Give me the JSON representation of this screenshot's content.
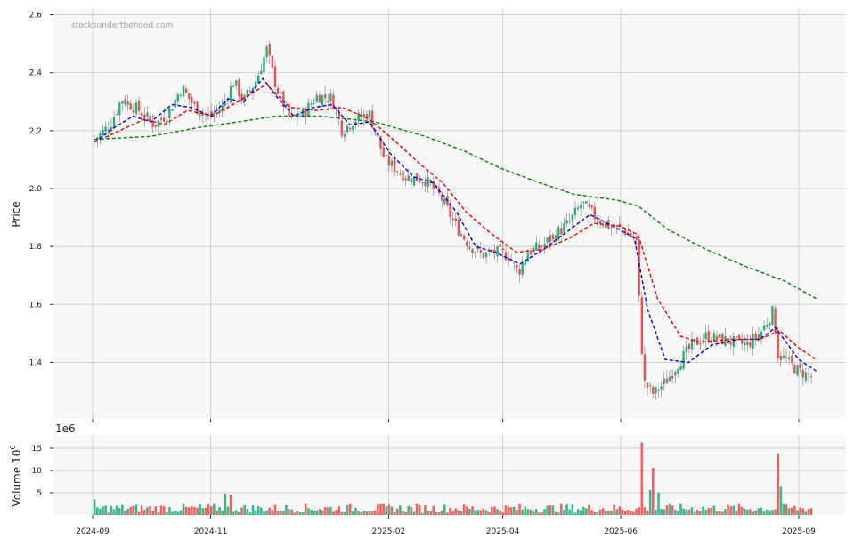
{
  "watermark": "stocksunderthehood.com",
  "colors": {
    "up": "#26b07a",
    "down": "#f05050",
    "ma_short": "#0000dd",
    "ma_mid": "#ee0000",
    "ma_long": "#008000",
    "panel_bg": "#f8f8f8",
    "grid": "#d0d0d0"
  },
  "chart_data": [
    {
      "type": "candlestick",
      "ylabel": "Price",
      "ylim": [
        1.205,
        2.62
      ],
      "yticks": [
        1.4,
        1.6,
        1.8,
        2.0,
        2.2,
        2.4,
        2.6
      ],
      "ytick_labels": [
        "1.4",
        "1.6",
        "1.8",
        "2.0",
        "2.2",
        "2.4",
        "2.6"
      ],
      "xticks": [
        "2024-09",
        "2024-11",
        "2025-02",
        "2025-04",
        "2025-06",
        "2025-09"
      ],
      "grid": true,
      "price_path": [
        [
          "2024-09-02",
          2.17
        ],
        [
          "2024-09-10",
          2.22
        ],
        [
          "2024-09-16",
          2.31
        ],
        [
          "2024-09-25",
          2.27
        ],
        [
          "2024-10-03",
          2.22
        ],
        [
          "2024-10-10",
          2.26
        ],
        [
          "2024-10-17",
          2.35
        ],
        [
          "2024-10-24",
          2.28
        ],
        [
          "2024-10-31",
          2.25
        ],
        [
          "2024-11-07",
          2.28
        ],
        [
          "2024-11-13",
          2.37
        ],
        [
          "2024-11-18",
          2.3
        ],
        [
          "2024-11-25",
          2.38
        ],
        [
          "2024-11-30",
          2.48
        ],
        [
          "2024-12-05",
          2.35
        ],
        [
          "2024-12-12",
          2.24
        ],
        [
          "2024-12-19",
          2.26
        ],
        [
          "2024-12-26",
          2.32
        ],
        [
          "2025-01-03",
          2.31
        ],
        [
          "2025-01-08",
          2.2
        ],
        [
          "2025-01-15",
          2.24
        ],
        [
          "2025-01-22",
          2.26
        ],
        [
          "2025-01-30",
          2.1
        ],
        [
          "2025-02-10",
          2.04
        ],
        [
          "2025-02-20",
          2.03
        ],
        [
          "2025-02-28",
          1.97
        ],
        [
          "2025-03-07",
          1.88
        ],
        [
          "2025-03-14",
          1.81
        ],
        [
          "2025-03-21",
          1.77
        ],
        [
          "2025-03-28",
          1.78
        ],
        [
          "2025-04-04",
          1.77
        ],
        [
          "2025-04-09",
          1.71
        ],
        [
          "2025-04-14",
          1.78
        ],
        [
          "2025-04-21",
          1.8
        ],
        [
          "2025-04-28",
          1.84
        ],
        [
          "2025-05-05",
          1.88
        ],
        [
          "2025-05-12",
          1.95
        ],
        [
          "2025-05-19",
          1.9
        ],
        [
          "2025-05-26",
          1.87
        ],
        [
          "2025-06-02",
          1.86
        ],
        [
          "2025-06-09",
          1.82
        ],
        [
          "2025-06-11",
          1.54
        ],
        [
          "2025-06-13",
          1.33
        ],
        [
          "2025-06-18",
          1.29
        ],
        [
          "2025-06-25",
          1.34
        ],
        [
          "2025-07-01",
          1.4
        ],
        [
          "2025-07-08",
          1.46
        ],
        [
          "2025-07-15",
          1.49
        ],
        [
          "2025-07-22",
          1.48
        ],
        [
          "2025-07-29",
          1.47
        ],
        [
          "2025-08-05",
          1.46
        ],
        [
          "2025-08-12",
          1.5
        ],
        [
          "2025-08-19",
          1.58
        ],
        [
          "2025-08-21",
          1.43
        ],
        [
          "2025-08-25",
          1.41
        ],
        [
          "2025-09-01",
          1.37
        ],
        [
          "2025-09-08",
          1.35
        ]
      ],
      "series": [
        {
          "name": "",
          "style": "dashed",
          "color_key": "ma_short",
          "points": [
            [
              "2024-09-02",
              2.16
            ],
            [
              "2024-09-12",
              2.21
            ],
            [
              "2024-09-22",
              2.25
            ],
            [
              "2024-10-01",
              2.23
            ],
            [
              "2024-10-12",
              2.29
            ],
            [
              "2024-10-22",
              2.28
            ],
            [
              "2024-11-01",
              2.25
            ],
            [
              "2024-11-10",
              2.31
            ],
            [
              "2024-11-18",
              2.3
            ],
            [
              "2024-11-28",
              2.38
            ],
            [
              "2024-12-06",
              2.31
            ],
            [
              "2024-12-14",
              2.25
            ],
            [
              "2024-12-24",
              2.28
            ],
            [
              "2025-01-03",
              2.29
            ],
            [
              "2025-01-12",
              2.22
            ],
            [
              "2025-01-22",
              2.23
            ],
            [
              "2025-02-02",
              2.12
            ],
            [
              "2025-02-14",
              2.04
            ],
            [
              "2025-02-24",
              2.02
            ],
            [
              "2025-03-08",
              1.92
            ],
            [
              "2025-03-18",
              1.8
            ],
            [
              "2025-03-28",
              1.78
            ],
            [
              "2025-04-10",
              1.74
            ],
            [
              "2025-04-22",
              1.79
            ],
            [
              "2025-05-04",
              1.85
            ],
            [
              "2025-05-16",
              1.91
            ],
            [
              "2025-05-28",
              1.87
            ],
            [
              "2025-06-08",
              1.83
            ],
            [
              "2025-06-15",
              1.58
            ],
            [
              "2025-06-24",
              1.41
            ],
            [
              "2025-07-06",
              1.4
            ],
            [
              "2025-07-18",
              1.46
            ],
            [
              "2025-08-01",
              1.48
            ],
            [
              "2025-08-12",
              1.48
            ],
            [
              "2025-08-20",
              1.52
            ],
            [
              "2025-09-01",
              1.41
            ],
            [
              "2025-09-10",
              1.37
            ]
          ]
        },
        {
          "name": "",
          "style": "dashed",
          "color_key": "ma_mid",
          "points": [
            [
              "2024-09-02",
              2.16
            ],
            [
              "2024-09-15",
              2.2
            ],
            [
              "2024-09-28",
              2.24
            ],
            [
              "2024-10-08",
              2.22
            ],
            [
              "2024-10-20",
              2.27
            ],
            [
              "2024-11-02",
              2.25
            ],
            [
              "2024-11-15",
              2.3
            ],
            [
              "2024-11-30",
              2.36
            ],
            [
              "2024-12-12",
              2.28
            ],
            [
              "2024-12-26",
              2.27
            ],
            [
              "2025-01-08",
              2.28
            ],
            [
              "2025-01-22",
              2.24
            ],
            [
              "2025-02-05",
              2.16
            ],
            [
              "2025-02-18",
              2.08
            ],
            [
              "2025-03-01",
              2.02
            ],
            [
              "2025-03-13",
              1.92
            ],
            [
              "2025-03-25",
              1.85
            ],
            [
              "2025-04-08",
              1.78
            ],
            [
              "2025-04-22",
              1.79
            ],
            [
              "2025-05-06",
              1.83
            ],
            [
              "2025-05-18",
              1.88
            ],
            [
              "2025-06-01",
              1.87
            ],
            [
              "2025-06-10",
              1.84
            ],
            [
              "2025-06-20",
              1.62
            ],
            [
              "2025-07-02",
              1.49
            ],
            [
              "2025-07-12",
              1.47
            ],
            [
              "2025-07-28",
              1.48
            ],
            [
              "2025-08-12",
              1.48
            ],
            [
              "2025-08-22",
              1.51
            ],
            [
              "2025-09-01",
              1.45
            ],
            [
              "2025-09-10",
              1.41
            ]
          ]
        },
        {
          "name": "",
          "style": "dashed",
          "color_key": "ma_long",
          "points": [
            [
              "2024-09-02",
              2.17
            ],
            [
              "2024-10-01",
              2.18
            ],
            [
              "2024-10-25",
              2.21
            ],
            [
              "2024-11-15",
              2.23
            ],
            [
              "2024-12-05",
              2.25
            ],
            [
              "2024-12-28",
              2.25
            ],
            [
              "2025-01-25",
              2.23
            ],
            [
              "2025-02-20",
              2.18
            ],
            [
              "2025-03-12",
              2.13
            ],
            [
              "2025-03-31",
              2.07
            ],
            [
              "2025-04-20",
              2.02
            ],
            [
              "2025-05-08",
              1.98
            ],
            [
              "2025-05-30",
              1.96
            ],
            [
              "2025-06-10",
              1.94
            ],
            [
              "2025-06-25",
              1.86
            ],
            [
              "2025-07-15",
              1.79
            ],
            [
              "2025-08-05",
              1.73
            ],
            [
              "2025-08-25",
              1.68
            ],
            [
              "2025-09-10",
              1.62
            ]
          ]
        }
      ]
    },
    {
      "type": "bar",
      "ylabel": "Volume",
      "ylabel_exponent": "6",
      "offset_label": "1e6",
      "ylim": [
        0,
        18
      ],
      "yticks": [
        5,
        10,
        15
      ],
      "ytick_labels": [
        "5",
        "10",
        "15"
      ],
      "grid": true,
      "notable_bars": [
        {
          "x": "2024-09-02",
          "value": 3.5,
          "dir": "up"
        },
        {
          "x": "2024-11-09",
          "value": 4.8,
          "dir": "up"
        },
        {
          "x": "2024-11-12",
          "value": 4.6,
          "dir": "down"
        },
        {
          "x": "2025-06-12",
          "value": 16.3,
          "dir": "down"
        },
        {
          "x": "2025-06-16",
          "value": 5.6,
          "dir": "up"
        },
        {
          "x": "2025-06-18",
          "value": 10.6,
          "dir": "down"
        },
        {
          "x": "2025-06-20",
          "value": 5.0,
          "dir": "up"
        },
        {
          "x": "2025-08-21",
          "value": 13.8,
          "dir": "down"
        },
        {
          "x": "2025-08-22",
          "value": 6.5,
          "dir": "up"
        }
      ],
      "baseline_range": [
        0.5,
        2.5
      ]
    }
  ]
}
